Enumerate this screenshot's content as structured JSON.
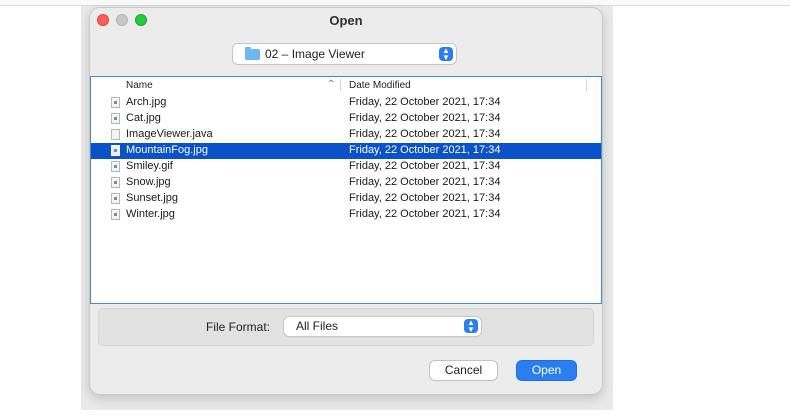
{
  "dialog": {
    "title": "Open",
    "folder": {
      "icon": "folder-icon",
      "label": "02 – Image Viewer"
    },
    "columns": {
      "name": "Name",
      "date": "Date Modified"
    },
    "files": [
      {
        "name": "Arch.jpg",
        "date": "Friday, 22 October 2021, 17:34",
        "icon": "image-file-icon",
        "selected": false
      },
      {
        "name": "Cat.jpg",
        "date": "Friday, 22 October 2021, 17:34",
        "icon": "image-file-icon",
        "selected": false
      },
      {
        "name": "ImageViewer.java",
        "date": "Friday, 22 October 2021, 17:34",
        "icon": "text-file-icon",
        "selected": false
      },
      {
        "name": "MountainFog.jpg",
        "date": "Friday, 22 October 2021, 17:34",
        "icon": "image-file-icon",
        "selected": true
      },
      {
        "name": "Smiley.gif",
        "date": "Friday, 22 October 2021, 17:34",
        "icon": "image-file-icon",
        "selected": false
      },
      {
        "name": "Snow.jpg",
        "date": "Friday, 22 October 2021, 17:34",
        "icon": "image-file-icon",
        "selected": false
      },
      {
        "name": "Sunset.jpg",
        "date": "Friday, 22 October 2021, 17:34",
        "icon": "image-file-icon",
        "selected": false
      },
      {
        "name": "Winter.jpg",
        "date": "Friday, 22 October 2021, 17:34",
        "icon": "image-file-icon",
        "selected": false
      }
    ],
    "format": {
      "label": "File Format:",
      "value": "All Files"
    },
    "buttons": {
      "cancel": "Cancel",
      "open": "Open"
    }
  },
  "colors": {
    "accent": "#2a7ef0",
    "selection": "#0a52c8",
    "close": "#ff5f57",
    "maximize": "#28c840"
  }
}
